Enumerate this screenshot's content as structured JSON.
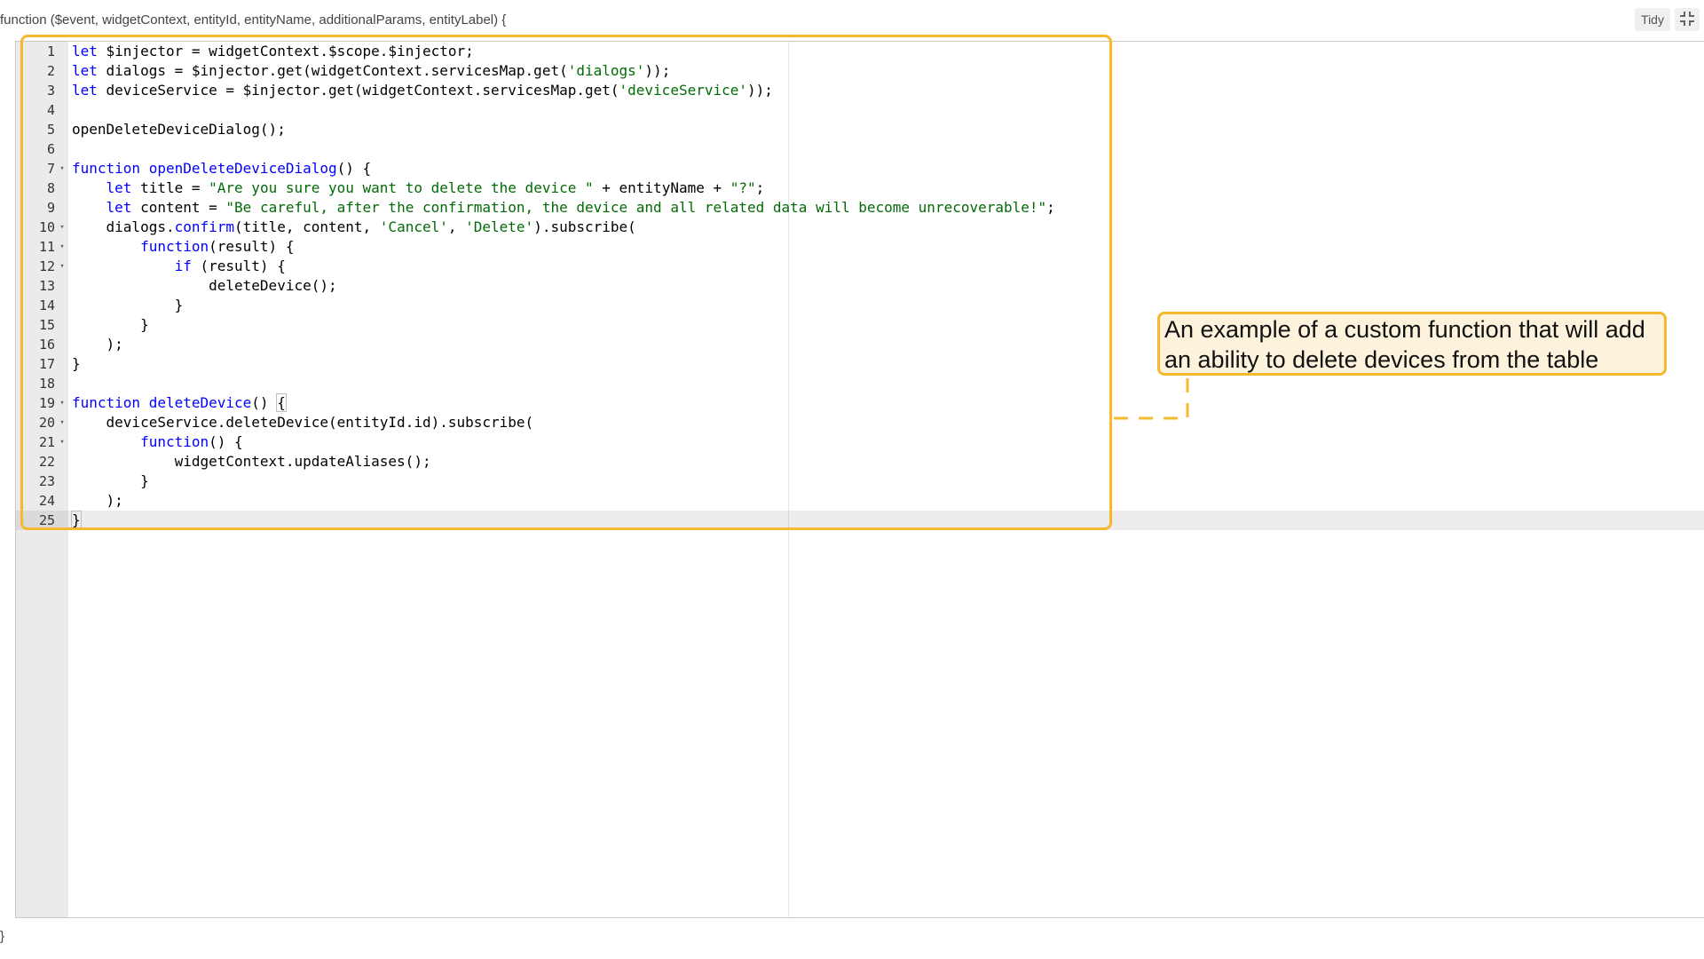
{
  "header": {
    "signature": "function ($event, widgetContext, entityId, entityName, additionalParams, entityLabel) {",
    "tidy_label": "Tidy",
    "fullscreen_icon": "collapse-icon"
  },
  "editor": {
    "active_line": 25,
    "lines": [
      {
        "n": "1",
        "fold": false,
        "html": "<span class=\"kw\">let</span> $injector = widgetContext.$scope.$injector;"
      },
      {
        "n": "2",
        "fold": false,
        "html": "<span class=\"kw\">let</span> dialogs = $injector.get(widgetContext.servicesMap.get(<span class=\"s2\">'dialogs'</span>));"
      },
      {
        "n": "3",
        "fold": false,
        "html": "<span class=\"kw\">let</span> deviceService = $injector.get(widgetContext.servicesMap.get(<span class=\"s2\">'deviceService'</span>));"
      },
      {
        "n": "4",
        "fold": false,
        "html": ""
      },
      {
        "n": "5",
        "fold": false,
        "html": "openDeleteDeviceDialog();"
      },
      {
        "n": "6",
        "fold": false,
        "html": ""
      },
      {
        "n": "7",
        "fold": true,
        "html": "<span class=\"kw\">function</span> <span class=\"kw\">openDeleteDeviceDialog</span>() {"
      },
      {
        "n": "8",
        "fold": false,
        "html": "    <span class=\"kw\">let</span> title = <span class=\"s2\">\"Are you sure you want to delete the device \"</span> + entityName + <span class=\"s2\">\"?\"</span>;"
      },
      {
        "n": "9",
        "fold": false,
        "html": "    <span class=\"kw\">let</span> content = <span class=\"s2\">\"Be careful, after the confirmation, the device and all related data will become unrecoverable!\"</span>;"
      },
      {
        "n": "10",
        "fold": true,
        "html": "    dialogs.<span class=\"kw\">confirm</span>(title, content, <span class=\"s2\">'Cancel'</span>, <span class=\"s2\">'Delete'</span>).subscribe("
      },
      {
        "n": "11",
        "fold": true,
        "html": "        <span class=\"kw\">function</span>(result) {"
      },
      {
        "n": "12",
        "fold": true,
        "html": "            <span class=\"kw\">if</span> (result) {"
      },
      {
        "n": "13",
        "fold": false,
        "html": "                deleteDevice();"
      },
      {
        "n": "14",
        "fold": false,
        "html": "            }"
      },
      {
        "n": "15",
        "fold": false,
        "html": "        }"
      },
      {
        "n": "16",
        "fold": false,
        "html": "    );"
      },
      {
        "n": "17",
        "fold": false,
        "html": "}"
      },
      {
        "n": "18",
        "fold": false,
        "html": ""
      },
      {
        "n": "19",
        "fold": true,
        "html": "<span class=\"kw\">function</span> <span class=\"kw\">deleteDevice</span>() <span class=\"bracket-hl\">{</span>"
      },
      {
        "n": "20",
        "fold": true,
        "html": "    deviceService.deleteDevice(entityId.id).subscribe("
      },
      {
        "n": "21",
        "fold": true,
        "html": "        <span class=\"kw\">function</span>() {"
      },
      {
        "n": "22",
        "fold": false,
        "html": "            widgetContext.updateAliases();"
      },
      {
        "n": "23",
        "fold": false,
        "html": "        }"
      },
      {
        "n": "24",
        "fold": false,
        "html": "    );"
      },
      {
        "n": "25",
        "fold": false,
        "html": "<span class=\"bracket-hl\">}</span>"
      }
    ]
  },
  "callout": {
    "text": "An example of a custom function that will add an ability to delete devices from the table",
    "border_color": "#f5b82e",
    "fill_color": "#fdf3dc"
  },
  "footer": {
    "closing_brace": "}"
  }
}
